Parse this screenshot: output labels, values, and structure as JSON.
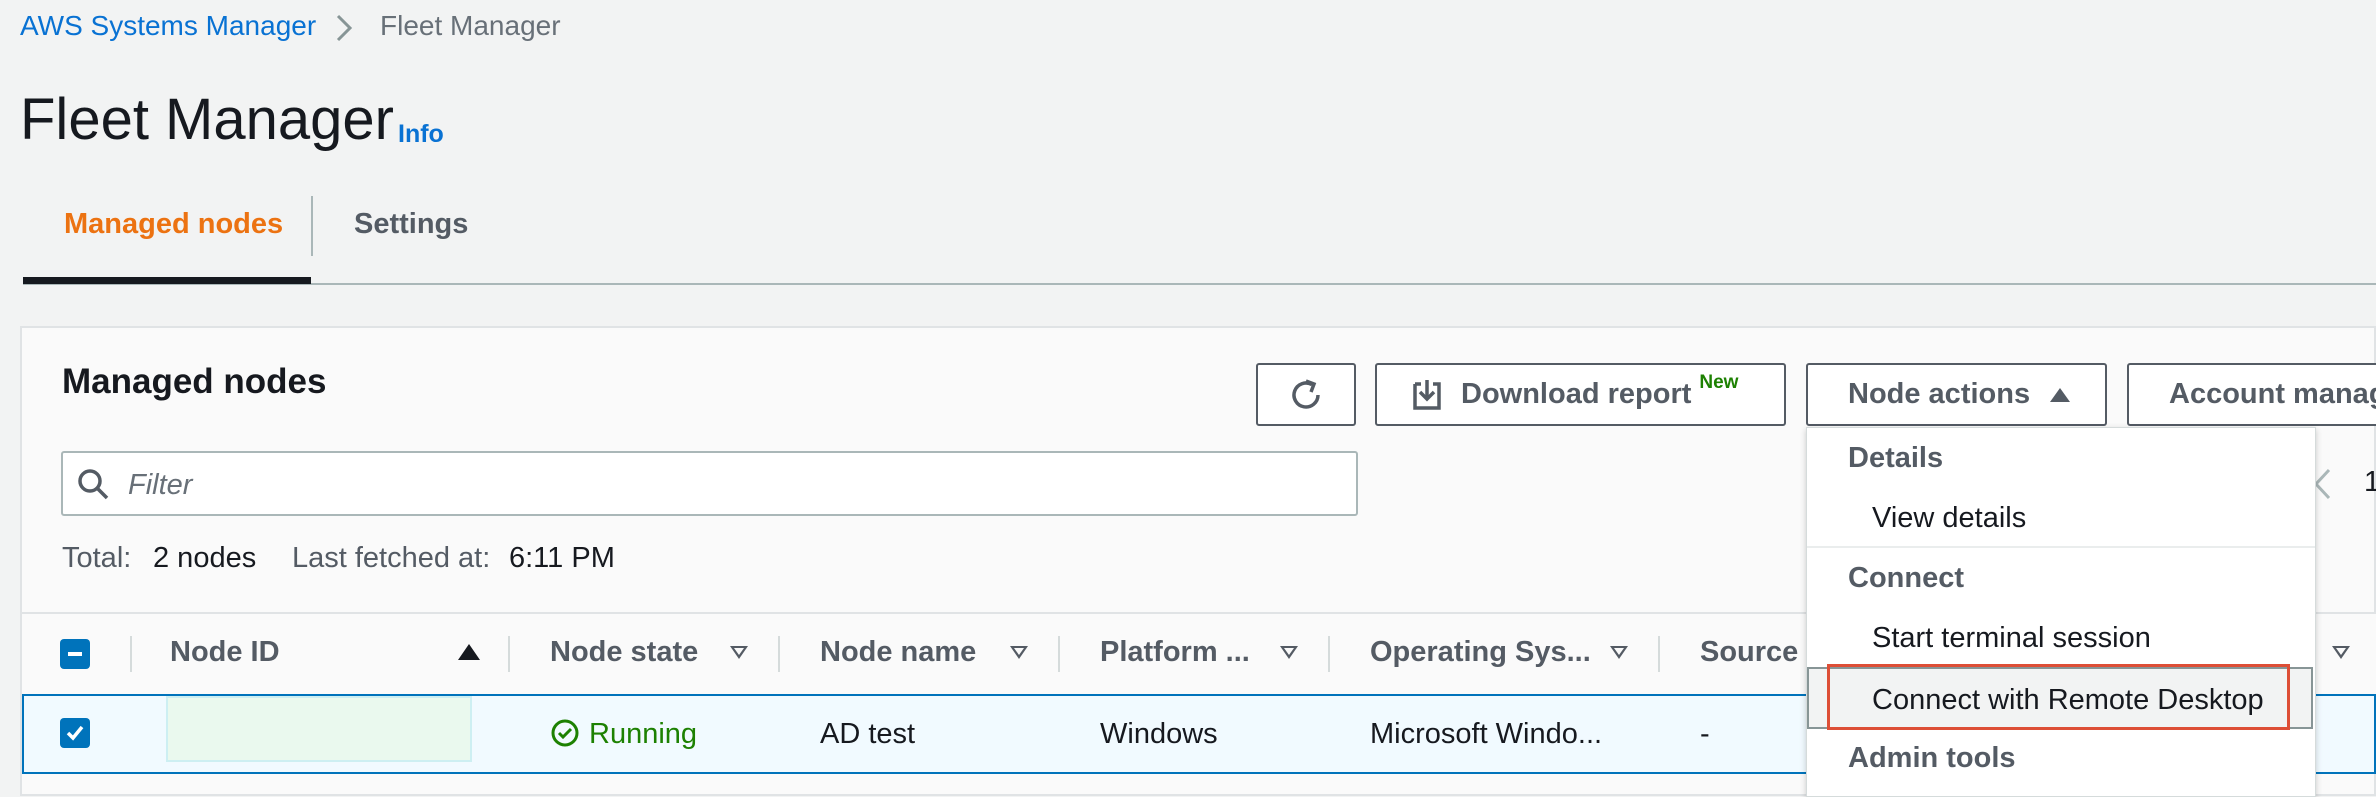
{
  "breadcrumb": {
    "root": "AWS Systems Manager",
    "current": "Fleet Manager"
  },
  "page": {
    "title": "Fleet Manager",
    "info": "Info"
  },
  "tabs": [
    {
      "label": "Managed nodes",
      "active": true
    },
    {
      "label": "Settings",
      "active": false
    }
  ],
  "panel": {
    "title": "Managed nodes",
    "buttons": {
      "download": "Download report",
      "download_badge": "New",
      "node_actions": "Node actions",
      "account": "Account manag"
    },
    "filter_placeholder": "Filter",
    "total_label": "Total:",
    "total_value": "2 nodes",
    "fetched_label": "Last fetched at:",
    "fetched_value": "6:11 PM",
    "pagination_page": "1"
  },
  "table": {
    "columns": [
      "Node ID",
      "Node state",
      "Node name",
      "Platform ...",
      "Operating Sys...",
      "Source t"
    ],
    "rows": [
      {
        "selected": true,
        "node_id": "",
        "state": "Running",
        "name": "AD test",
        "platform": "Windows",
        "os": "Microsoft Windo...",
        "source": "-"
      }
    ]
  },
  "dropdown": {
    "groups": [
      {
        "label": "Details",
        "items": [
          "View details"
        ]
      },
      {
        "label": "Connect",
        "items": [
          "Start terminal session",
          "Connect with Remote Desktop"
        ]
      },
      {
        "label": "Admin tools",
        "items": []
      }
    ]
  },
  "colors": {
    "link": "#0972d3",
    "tab_active": "#ec7211",
    "running": "#1d8102",
    "selected_row_border": "#0073bb",
    "highlight_box": "#dd4e36"
  },
  "icons": [
    "chevron-right-icon",
    "refresh-icon",
    "download-icon",
    "caret-up-icon",
    "search-icon",
    "checkbox-indeterminate-icon",
    "checkbox-checked-icon",
    "check-circle-icon",
    "sort-ascending-icon",
    "filter-caret-icon",
    "chevron-left-icon"
  ]
}
